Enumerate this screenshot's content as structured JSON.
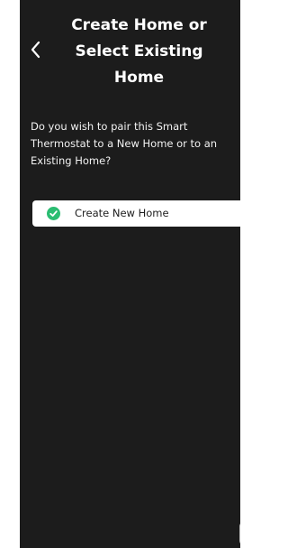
{
  "header": {
    "title": "Create Home or Select Existing Home",
    "back_icon": "chevron-left-icon"
  },
  "content": {
    "question": "Do you wish to pair this Smart Thermostat to a New Home or to an Existing Home?"
  },
  "options": [
    {
      "label": "Create New Home",
      "selected": true,
      "icon": "check-circle-icon"
    }
  ],
  "footer": {
    "next_icon": "arrow-right-icon"
  },
  "colors": {
    "background": "#1c1c1c",
    "text": "#ffffff",
    "card": "#ffffff",
    "accent": "#2bbd72"
  }
}
